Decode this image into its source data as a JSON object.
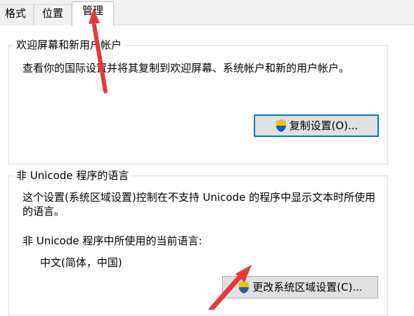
{
  "tabs": [
    {
      "label": "格式"
    },
    {
      "label": "位置"
    },
    {
      "label": "管理",
      "active": true
    }
  ],
  "welcome": {
    "title": "欢迎屏幕和新用户帐户",
    "description": "查看你的国际设置并将其复制到欢迎屏幕、系统帐户和新的用户帐户。",
    "copy_button": "复制设置(O)...",
    "button_icon": "uac-shield-icon"
  },
  "non_unicode": {
    "title": "非 Unicode 程序的语言",
    "description_line1": "这个设置(系统区域设置)控制在不支持 Unicode 的程序中显示文本时所使用",
    "description_line2": "的语言。",
    "current_label": "非 Unicode 程序中所使用的当前语言:",
    "current_value": "中文(简体，中国)",
    "change_button": "更改系统区域设置(C)...",
    "button_icon": "uac-shield-icon"
  },
  "annotation_color": "#e8373a"
}
